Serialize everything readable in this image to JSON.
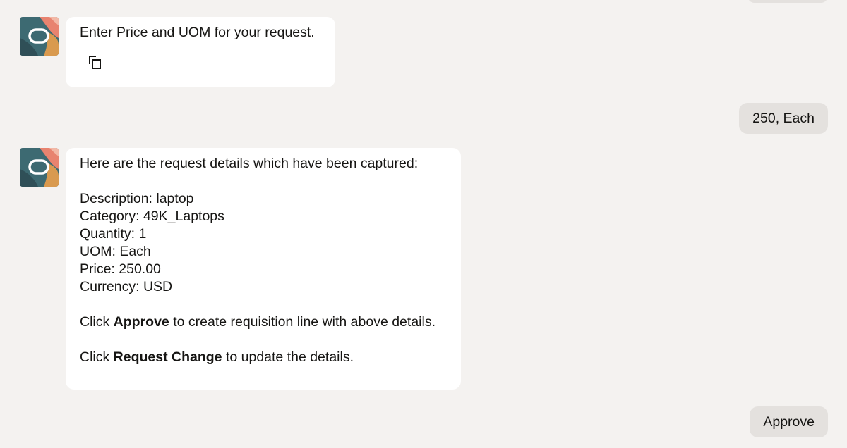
{
  "colors": {
    "background": "#f4f2f0",
    "bot_bubble": "#ffffff",
    "user_bubble": "#e4e1de",
    "text": "#161513"
  },
  "messages": [
    {
      "sender": "bot",
      "text": "Enter Price and UOM for your request.",
      "copy_icon": "copy-icon"
    },
    {
      "sender": "user",
      "text": "250, Each"
    },
    {
      "sender": "bot",
      "intro": "Here are the request details which have been captured:",
      "details": [
        "Description: laptop",
        "Category: 49K_Laptops",
        "Quantity: 1",
        "UOM: Each",
        "Price: 250.00",
        "Currency: USD"
      ],
      "approve_line": {
        "prefix": "Click ",
        "bold": "Approve",
        "suffix": " to create requisition line with above details."
      },
      "change_line": {
        "prefix": "Click ",
        "bold": "Request Change",
        "suffix": " to update the details."
      }
    }
  ],
  "actions": {
    "approve_label": "Approve"
  },
  "avatar_icon": "assistant-avatar-icon"
}
